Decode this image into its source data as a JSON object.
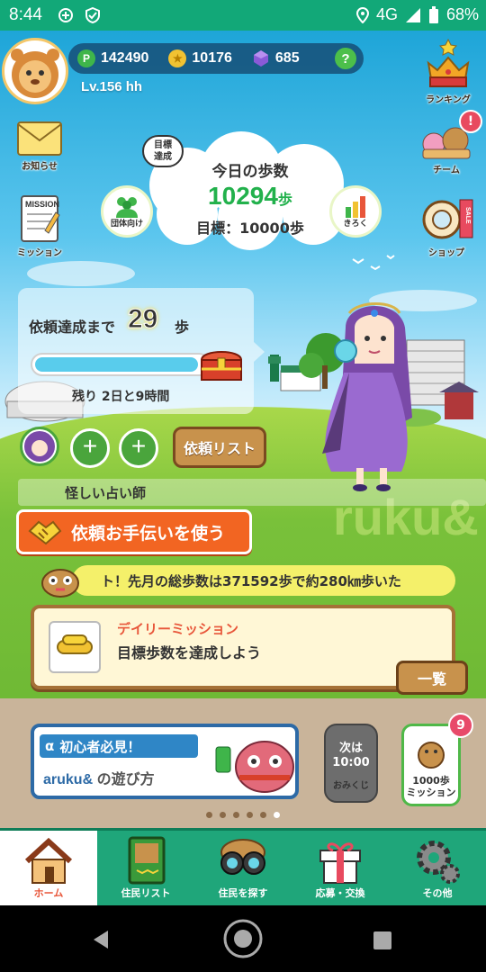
{
  "status_bar": {
    "time": "8:44",
    "network": "4G",
    "battery": "68%"
  },
  "player": {
    "level": "Lv.156 hh",
    "points": "142490",
    "coins": "10176",
    "gems": "685",
    "help": "?"
  },
  "left_menu": {
    "news": "お知らせ",
    "mission": "ミッション",
    "mission_card_text": "MISSION"
  },
  "right_menu": {
    "ranking": "ランキング",
    "team": "チーム",
    "team_badge": "!",
    "shop": "ショップ",
    "shop_tag": "SALE"
  },
  "steps": {
    "title": "今日の歩数",
    "count": "10294",
    "unit": "歩",
    "goal": "目標：10000歩",
    "goal_bubble": "目標\n達成",
    "group_label": "団体向け",
    "record_label": "きろく"
  },
  "request": {
    "label": "依頼達成まで",
    "remaining_steps": "29",
    "unit": "歩",
    "progress": 0.95,
    "time_left": "残り 2日と9時間",
    "add_symbol": "+",
    "list_button": "依頼リスト",
    "character_name": "怪しい占い師",
    "help_button": "依頼お手伝いを使う"
  },
  "ticker": {
    "text": "ト！先月の総歩数は371592歩で約280㎞歩いた"
  },
  "daily_mission": {
    "title": "デイリーミッション",
    "description": "目標歩数を達成しよう",
    "list_button": "一覧"
  },
  "banner": {
    "headline": "初心者必見！",
    "brand": "aruku&",
    "suffix": "の遊び方"
  },
  "omikuji": {
    "next_label": "次は",
    "time": "10:00",
    "seal": "おみくじ"
  },
  "step_mission": {
    "label": "1000歩\nミッション",
    "badge": "9"
  },
  "carousel": {
    "count": 6,
    "active": 5
  },
  "tabs": [
    {
      "label": "ホーム",
      "icon": "house-icon"
    },
    {
      "label": "住民リスト",
      "icon": "book-icon"
    },
    {
      "label": "住民を探す",
      "icon": "binoculars-icon"
    },
    {
      "label": "応募・交換",
      "icon": "gift-icon"
    },
    {
      "label": "その他",
      "icon": "gear-icon"
    }
  ],
  "colors": {
    "accent_green": "#1fa67a",
    "step_green": "#22b14c",
    "orange_button": "#f26522",
    "mission_red": "#e8563a"
  }
}
